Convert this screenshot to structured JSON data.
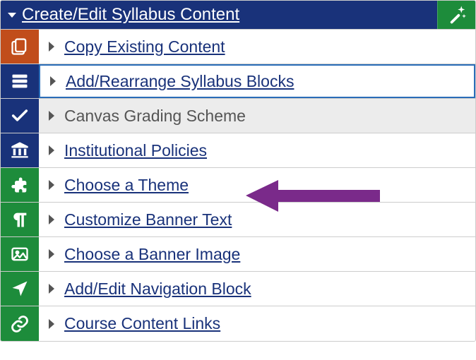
{
  "colors": {
    "navy": "#19327a",
    "orange": "#c14d1b",
    "green": "#1d8c3b",
    "arrow": "#7a2a8a",
    "disabled_bg": "#ececec",
    "disabled_text": "#555"
  },
  "panel": {
    "title": "Create/Edit Syllabus Content",
    "magic_button": "magic-wand"
  },
  "rows": [
    {
      "icon": "copy-icon",
      "icon_bg": "bg-orange",
      "label": "Copy Existing Content",
      "link": true,
      "state": "normal"
    },
    {
      "icon": "blocks-icon",
      "icon_bg": "bg-navy",
      "label": "Add/Rearrange Syllabus Blocks",
      "link": true,
      "state": "selected"
    },
    {
      "icon": "check-icon",
      "icon_bg": "bg-navy",
      "label": "Canvas Grading Scheme",
      "link": false,
      "state": "disabled"
    },
    {
      "icon": "institution-icon",
      "icon_bg": "bg-navy",
      "label": "Institutional Policies",
      "link": true,
      "state": "normal"
    },
    {
      "icon": "puzzle-icon",
      "icon_bg": "bg-green",
      "label": "Choose a Theme",
      "link": true,
      "state": "normal"
    },
    {
      "icon": "paragraph-icon",
      "icon_bg": "bg-green",
      "label": "Customize Banner Text",
      "link": true,
      "state": "normal"
    },
    {
      "icon": "image-icon",
      "icon_bg": "bg-green",
      "label": "Choose a Banner Image",
      "link": true,
      "state": "normal"
    },
    {
      "icon": "nav-arrow-icon",
      "icon_bg": "bg-green",
      "label": "Add/Edit Navigation Block",
      "link": true,
      "state": "normal"
    },
    {
      "icon": "link-icon",
      "icon_bg": "bg-green",
      "label": "Course Content Links",
      "link": true,
      "state": "normal"
    }
  ],
  "annotation": {
    "target_row_index": 4,
    "shape": "arrow-left"
  }
}
